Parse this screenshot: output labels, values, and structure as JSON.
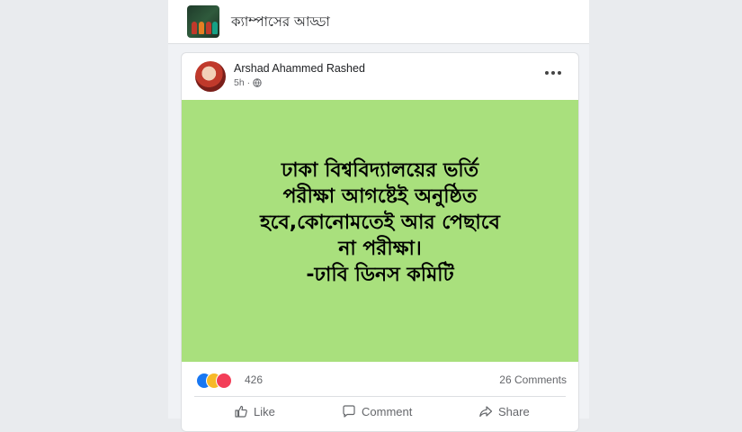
{
  "group": {
    "name": "ক্যাম্পাসের আড্ডা"
  },
  "post": {
    "author": "Arshad Ahammed Rashed",
    "time": "5h ·",
    "background_color": "#a9e07d",
    "text_lines": [
      "ঢাকা বিশ্ববিদ্যালয়ের ভর্তি",
      "পরীক্ষা আগষ্টেই অনুষ্ঠিত",
      "হবে,কোনোমতেই আর পেছাবে",
      "না পরীক্ষা।",
      "-ঢাবি ডিনস কমিটি"
    ],
    "reactions": {
      "types": [
        "like-icon",
        "haha-icon",
        "love-icon"
      ],
      "count": "426"
    },
    "comments_label": "26 Comments"
  },
  "actions": {
    "like_label": "Like",
    "comment_label": "Comment",
    "share_label": "Share"
  }
}
